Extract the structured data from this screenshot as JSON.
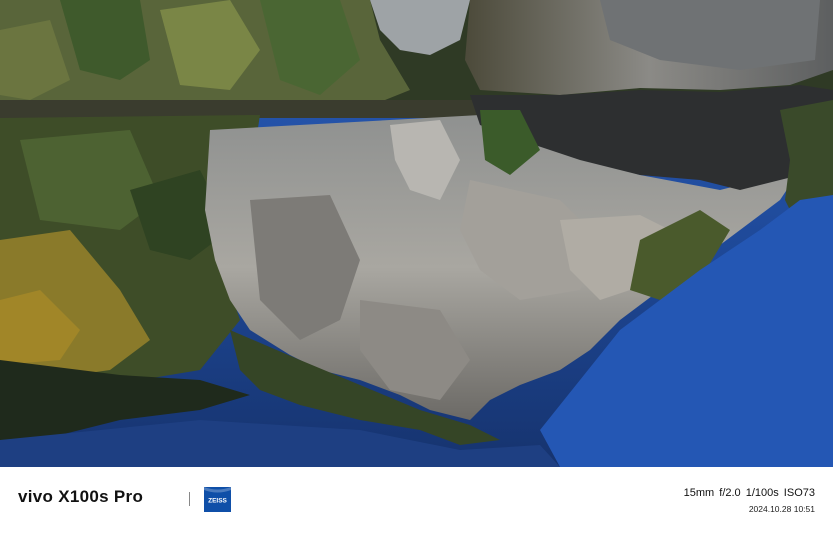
{
  "watermark": {
    "brand_model": "vivo X100s Pro",
    "lens_brand_logo": "zeiss-logo",
    "lens_brand_text": "ZEISS",
    "params": "15mm  f/2.0  1/100s  ISO73",
    "datetime": "2024.10.28 10:51"
  },
  "colors": {
    "water_blue": "#1f4a9a",
    "zeiss_blue": "#0f4fa8",
    "bar_background": "#ffffff"
  }
}
